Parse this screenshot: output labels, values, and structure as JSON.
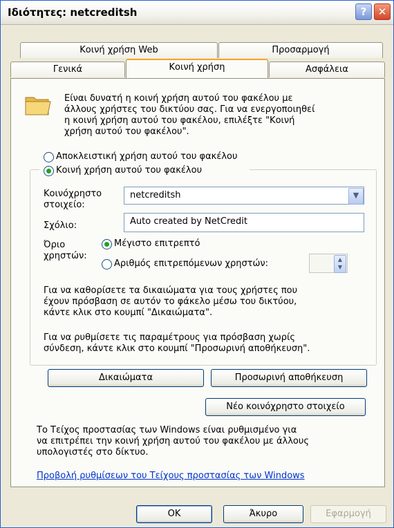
{
  "window": {
    "title": "Ιδιότητες: netcreditsh",
    "help_glyph": "?",
    "close_glyph": "✕"
  },
  "tabs": {
    "row1": [
      "Κοινή χρήση Web",
      "Προσαρμογή"
    ],
    "row2": [
      "Γενικά",
      "Κοινή χρήση",
      "Ασφάλεια"
    ]
  },
  "intro": {
    "line1": "Είναι δυνατή η κοινή χρήση αυτού του φακέλου με",
    "line2": "άλλους χρήστες του δικτύου σας. Για να ενεργοποιηθεί",
    "line3": "η κοινή χρήση αυτού του φακέλου, επιλέξτε \"Κοινή",
    "line4": "χρήση αυτού του φακέλου\"."
  },
  "options": {
    "exclusive": "Αποκλειστική χρήση αυτού του φακέλου",
    "shared": "Κοινή χρήση αυτού του φακέλου"
  },
  "share": {
    "name_label_1": "Κοινόχρηστο",
    "name_label_2": "στοιχείο:",
    "name_value": "netcreditsh",
    "comment_label": "Σχόλιο:",
    "comment_value": "Auto created by NetCredit",
    "limit_label_1": "Όριο",
    "limit_label_2": "χρηστών:",
    "max_allowed": "Μέγιστο επιτρεπτό",
    "allowed_users": "Αριθμός επιτρεπόμενων χρηστών:"
  },
  "perm_text": {
    "line1": "Για να καθορίσετε τα δικαιώματα για τους χρήστες που",
    "line2": "έχουν πρόσβαση σε αυτόν το φάκελο μέσω του δικτύου,",
    "line3": "κάντε κλικ στο κουμπί \"Δικαιώματα\"."
  },
  "cache_text": {
    "line1": "Για να ρυθμίσετε τις παραμέτρους για πρόσβαση χωρίς",
    "line2": "σύνδεση, κάντε κλικ στο κουμπί \"Προσωρινή αποθήκευση\"."
  },
  "buttons": {
    "permissions": "Δικαιώματα",
    "caching": "Προσωρινή αποθήκευση",
    "new_share": "Νέο κοινόχρηστο στοιχείο",
    "ok": "OK",
    "cancel": "Άκυρο",
    "apply": "Εφαρμογή"
  },
  "firewall": {
    "line1": "Το Τείχος προστασίας των Windows είναι ρυθμισμένο για",
    "line2": "να επιτρέπει την κοινή χρήση αυτού του φακέλου με άλλους",
    "line3": "υπολογιστές στο δίκτυο.",
    "link": "Προβολή ρυθμίσεων του Τείχους προστασίας των Windows"
  },
  "icons": {
    "folder": "shared-folder-icon",
    "dropdown": "chevron-down-icon",
    "spinner": "spin-arrows-icon"
  },
  "colors": {
    "title_border": "#2a5dce",
    "tab_highlight": "#f5a623",
    "radio_dot": "#21a121",
    "link": "#0033cc"
  }
}
